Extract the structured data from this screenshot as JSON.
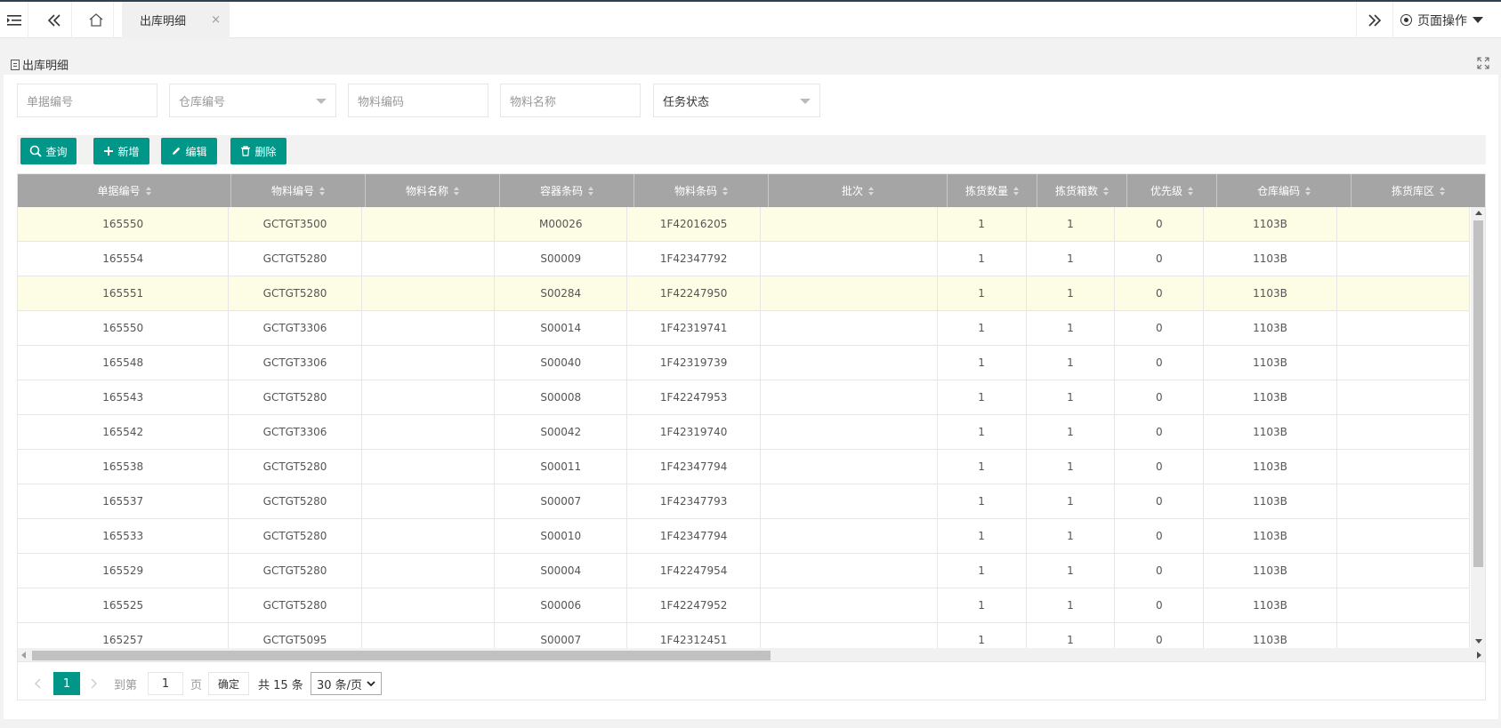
{
  "tabs": [
    {
      "label": "出库明细",
      "close": "×"
    }
  ],
  "header": {
    "page_ops_label": "页面操作"
  },
  "panel": {
    "title": "出库明细"
  },
  "filters": {
    "doc_no_placeholder": "单据编号",
    "warehouse_placeholder": "仓库编号",
    "material_code_placeholder": "物料编码",
    "material_name_placeholder": "物料名称",
    "task_status_value": "任务状态"
  },
  "toolbar": {
    "query": "查询",
    "add": "新增",
    "edit": "编辑",
    "delete": "删除"
  },
  "table": {
    "columns": [
      "单据编号",
      "物料编号",
      "物料名称",
      "容器条码",
      "物料条码",
      "批次",
      "拣货数量",
      "拣货箱数",
      "优先级",
      "仓库编码",
      "拣货库区"
    ],
    "rows": [
      [
        "165550",
        "GCTGT3500",
        "",
        "M00026",
        "1F42016205",
        "",
        "1",
        "1",
        "0",
        "1103B",
        ""
      ],
      [
        "165554",
        "GCTGT5280",
        "",
        "S00009",
        "1F42347792",
        "",
        "1",
        "1",
        "0",
        "1103B",
        ""
      ],
      [
        "165551",
        "GCTGT5280",
        "",
        "S00284",
        "1F42247950",
        "",
        "1",
        "1",
        "0",
        "1103B",
        ""
      ],
      [
        "165550",
        "GCTGT3306",
        "",
        "S00014",
        "1F42319741",
        "",
        "1",
        "1",
        "0",
        "1103B",
        ""
      ],
      [
        "165548",
        "GCTGT3306",
        "",
        "S00040",
        "1F42319739",
        "",
        "1",
        "1",
        "0",
        "1103B",
        ""
      ],
      [
        "165543",
        "GCTGT5280",
        "",
        "S00008",
        "1F42247953",
        "",
        "1",
        "1",
        "0",
        "1103B",
        ""
      ],
      [
        "165542",
        "GCTGT3306",
        "",
        "S00042",
        "1F42319740",
        "",
        "1",
        "1",
        "0",
        "1103B",
        ""
      ],
      [
        "165538",
        "GCTGT5280",
        "",
        "S00011",
        "1F42347794",
        "",
        "1",
        "1",
        "0",
        "1103B",
        ""
      ],
      [
        "165537",
        "GCTGT5280",
        "",
        "S00007",
        "1F42347793",
        "",
        "1",
        "1",
        "0",
        "1103B",
        ""
      ],
      [
        "165533",
        "GCTGT5280",
        "",
        "S00010",
        "1F42347794",
        "",
        "1",
        "1",
        "0",
        "1103B",
        ""
      ],
      [
        "165529",
        "GCTGT5280",
        "",
        "S00004",
        "1F42247954",
        "",
        "1",
        "1",
        "0",
        "1103B",
        ""
      ],
      [
        "165525",
        "GCTGT5280",
        "",
        "S00006",
        "1F42247952",
        "",
        "1",
        "1",
        "0",
        "1103B",
        ""
      ],
      [
        "165257",
        "GCTGT5095",
        "",
        "S00007",
        "1F42312451",
        "",
        "1",
        "1",
        "0",
        "1103B",
        ""
      ]
    ],
    "highlighted_rows": [
      0,
      2
    ]
  },
  "pagination": {
    "current_page": "1",
    "goto_label": "到第",
    "goto_value": "1",
    "page_suffix": "页",
    "confirm": "确定",
    "total": "共 15 条",
    "page_size": "30 条/页"
  },
  "colors": {
    "accent": "#009688",
    "header_bg": "#a5a5a5",
    "highlight_row": "#fdfde6"
  }
}
